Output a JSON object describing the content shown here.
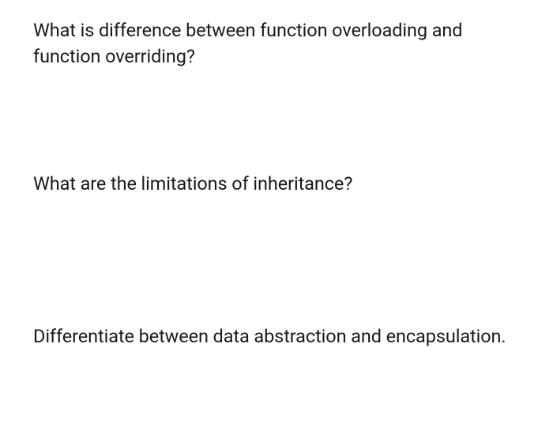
{
  "questions": [
    "What is difference between function overloading and function overriding?",
    "What are the limitations of inheritance?",
    "Differentiate between data abstraction and encapsulation."
  ]
}
